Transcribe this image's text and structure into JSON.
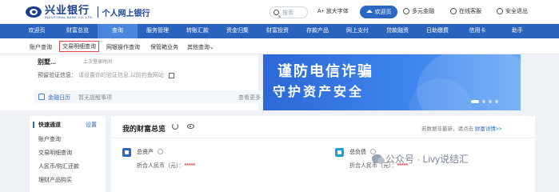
{
  "header": {
    "logo_cn": "兴业银行",
    "logo_en": "INDUSTRIAL BANK CO.,LTD.",
    "logo_sub": "个人网上银行",
    "search_placeholder": "搜索",
    "font_toggle": "A+ 放大字体",
    "home_label": "欢迎页",
    "multi_currency": "多元金融",
    "online_service": "在线客服",
    "logout": "安全退出"
  },
  "nav": {
    "items": [
      "欢迎页",
      "财富总览",
      "查询",
      "服务管理",
      "转账汇款",
      "资金归集",
      "财富投资",
      "存款产品",
      "网上支付",
      "贷款融资",
      "日助缴费",
      "信用卡",
      "助手"
    ],
    "active_index": 2
  },
  "subnav": {
    "items": [
      "账户查询",
      "交易明细查询",
      "网银操作查询",
      "保管箱业务",
      "其他查询"
    ],
    "active_index": 1
  },
  "user": {
    "greeting": "别墅...",
    "greeting_sub": "上次登录时间",
    "verify_label": "预留验证信息：",
    "verify_hint": "请设置你的验证信息,以防钓鱼网站",
    "calendar_label": "金融日历",
    "pending_text": "暂无提醒事项",
    "more": "查看更多 ›"
  },
  "banner": {
    "line1": "谨防电信诈骗",
    "line2": "守护资产安全",
    "dot_count": 4,
    "active_dot": 0
  },
  "sidebar": {
    "title": "快速通道",
    "settings": "设置",
    "items": [
      "账户查询",
      "交易明细查询",
      "人民币/购汇还款",
      "理财产品购买"
    ]
  },
  "overview": {
    "title": "我的财富总览",
    "hint": "若数据非最新，请点击",
    "hint_link": "财富详情>>",
    "assets_label": "总资产",
    "assets_value_label": "折合人民币（元）：",
    "assets_value": "*****",
    "liabilities_label": "总负债",
    "liabilities_value_label": "折合人民币（元）：",
    "liabilities_value": "*****"
  },
  "watermark": "公众号 · Livy说结汇",
  "colors": {
    "brand": "#2a63bd",
    "nav_active": "#4a86dc",
    "highlight_border": "#e04848",
    "masked_value": "#e04848"
  }
}
